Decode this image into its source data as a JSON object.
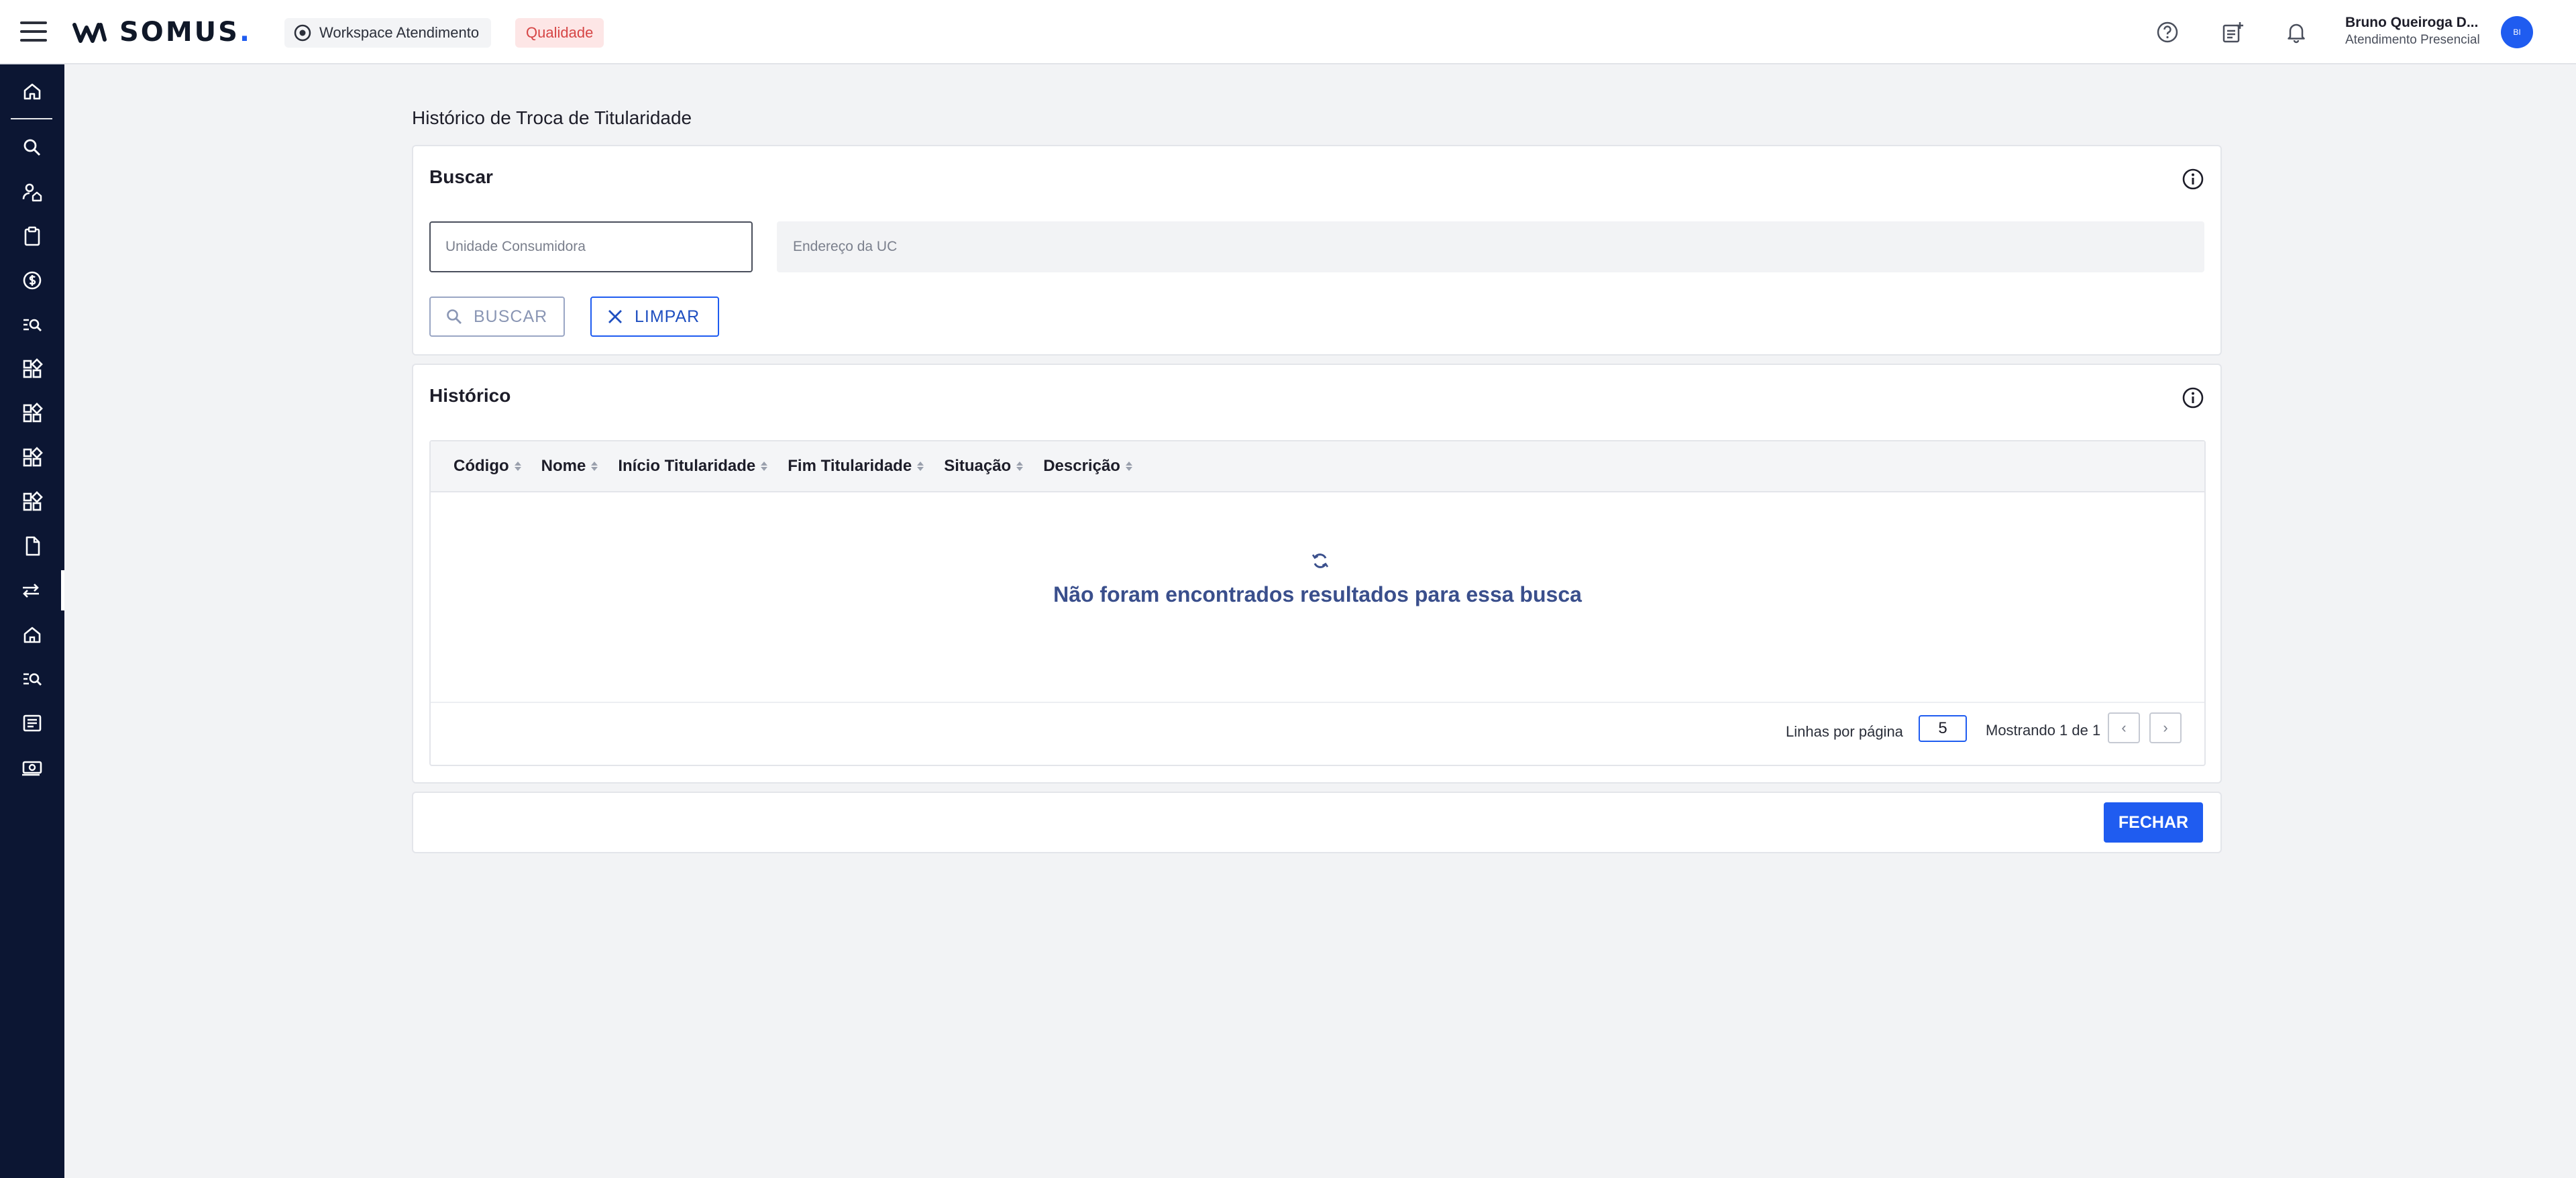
{
  "header": {
    "brand": "SOMUS",
    "brand_dot": ".",
    "workspace_label": "Workspace Atendimento",
    "environment_badge": "Qualidade",
    "user_name": "Bruno Queiroga D...",
    "user_role": "Atendimento Presencial",
    "avatar_initials": "BI",
    "icons": [
      "menu-icon",
      "eye-icon",
      "help-icon",
      "add-note-icon",
      "bell-icon"
    ]
  },
  "sidebar": {
    "items": [
      {
        "icon": "home-icon"
      },
      {
        "icon": "search-icon"
      },
      {
        "icon": "user-house-icon"
      },
      {
        "icon": "clipboard-icon"
      },
      {
        "icon": "dollar-icon"
      },
      {
        "icon": "list-search-icon"
      },
      {
        "icon": "grid-plus-icon"
      },
      {
        "icon": "grid-plus-icon"
      },
      {
        "icon": "grid-plus-icon"
      },
      {
        "icon": "grid-plus-icon"
      },
      {
        "icon": "document-icon"
      },
      {
        "icon": "swap-icon",
        "active": true
      },
      {
        "icon": "home-icon"
      },
      {
        "icon": "list-search-icon"
      },
      {
        "icon": "receipt-icon"
      },
      {
        "icon": "money-icon"
      }
    ]
  },
  "page": {
    "title": "Histórico de Troca de Titularidade"
  },
  "search": {
    "title": "Buscar",
    "uc_placeholder": "Unidade Consumidora",
    "uc_value": "",
    "address_placeholder": "Endereço da UC",
    "address_value": "",
    "buscar_label": "BUSCAR",
    "limpar_label": "LIMPAR"
  },
  "history": {
    "title": "Histórico",
    "columns": [
      "Código",
      "Nome",
      "Início Titularidade",
      "Fim Titularidade",
      "Situação",
      "Descrição"
    ],
    "rows": [],
    "empty_message": "Não foram encontrados resultados para essa busca",
    "rows_per_page_label": "Linhas por página",
    "rows_per_page": "5",
    "showing_text": "Mostrando 1 de 1",
    "prev_label": "‹",
    "next_label": "›"
  },
  "footer": {
    "close_label": "FECHAR"
  },
  "colors": {
    "primary": "#1f5cf0",
    "sidebar_bg": "#0c1633",
    "badge_bg": "#fde6e6",
    "badge_text": "#d64545",
    "empty_text": "#3a4f8c"
  }
}
